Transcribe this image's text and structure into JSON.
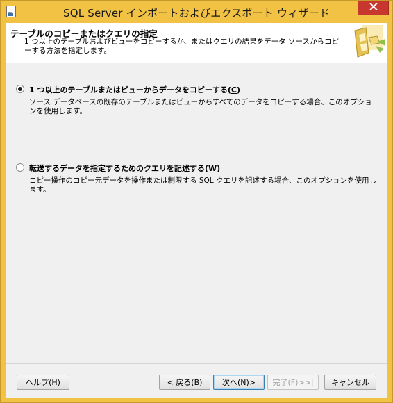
{
  "window": {
    "title": "SQL Server インポートおよびエクスポート ウィザード"
  },
  "header": {
    "title": "テーブルのコピーまたはクエリの指定",
    "description": "1 つ以上のテーブルおよびビューをコピーするか、またはクエリの結果をデータ ソースからコピーする方法を指定します。",
    "graphic_icon": "wizard-graphic-icon"
  },
  "options": [
    {
      "label": "1 つ以上のテーブルまたはビューからデータをコピーする(C)",
      "label_text": "1 つ以上のテーブルまたはビューからデータをコピーする",
      "accelerator": "C",
      "description": "ソース データベースの既存のテーブルまたはビューからすべてのデータをコピーする場合、このオプションを使用します。",
      "selected": true
    },
    {
      "label": "転送するデータを指定するためのクエリを記述する(W)",
      "label_text": "転送するデータを指定するためのクエリを記述する",
      "accelerator": "W",
      "description": "コピー操作のコピー元データを操作または制限する SQL クエリを記述する場合、このオプションを使用します。",
      "selected": false
    }
  ],
  "buttons": {
    "help_text": "ヘルプ",
    "help_key": "H",
    "back_text": "< 戻る",
    "back_key": "B",
    "next_text": "次へ",
    "next_key": "N",
    "next_suffix": " >",
    "finish_text": "完了",
    "finish_key": "F",
    "finish_suffix": " >>|",
    "cancel_text": "キャンセル"
  },
  "colors": {
    "frame": "#f2c244",
    "close": "#c7372e",
    "client": "#f0f0f0"
  }
}
